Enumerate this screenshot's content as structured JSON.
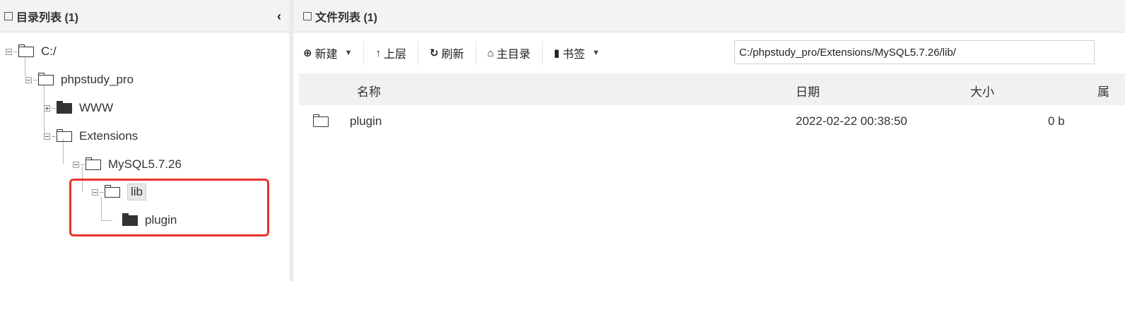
{
  "left_panel": {
    "title": "目录列表 (1)",
    "collapse": "‹",
    "tree": {
      "root": "C:/",
      "phpstudy": "phpstudy_pro",
      "www": "WWW",
      "extensions": "Extensions",
      "mysql": "MySQL5.7.26",
      "lib": "lib",
      "plugin": "plugin"
    }
  },
  "right_panel": {
    "title": "文件列表 (1)",
    "toolbar": {
      "new": "新建",
      "up": "上层",
      "refresh": "刷新",
      "home": "主目录",
      "bookmark": "书签"
    },
    "path": "C:/phpstudy_pro/Extensions/MySQL5.7.26/lib/",
    "columns": {
      "name": "名称",
      "date": "日期",
      "size": "大小",
      "perm": "属"
    },
    "rows": [
      {
        "name": "plugin",
        "date": "2022-02-22 00:38:50",
        "size": "0 b"
      }
    ]
  },
  "colors": {
    "highlight": "#e8332a",
    "header_bg": "#f3f3f3"
  },
  "icons": {
    "new": "plus-circle-icon",
    "up": "arrow-up-icon",
    "refresh": "refresh-icon",
    "home": "home-icon",
    "bookmark": "bookmark-icon"
  }
}
